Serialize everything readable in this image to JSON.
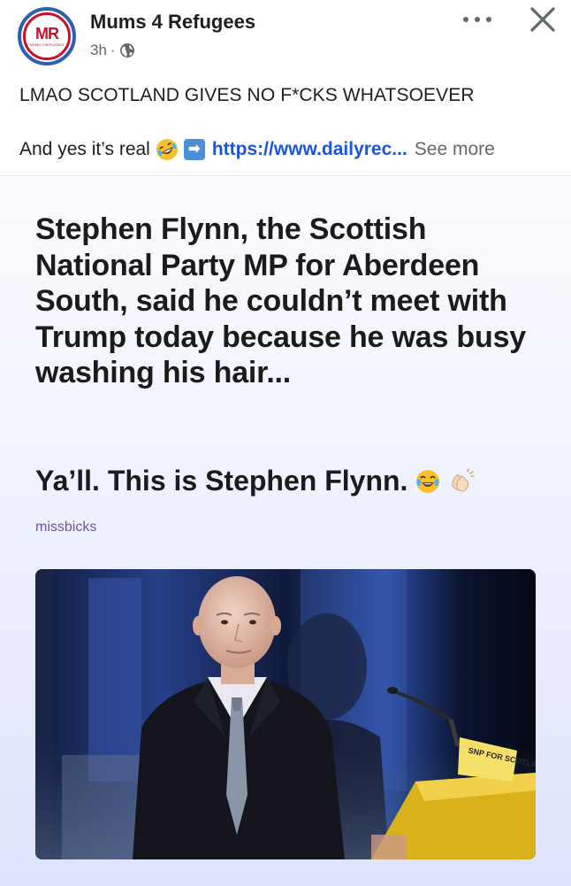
{
  "post": {
    "page_name": "Mums 4 Refugees",
    "time": "3h",
    "separator": "·",
    "avatar_logo": "MR",
    "avatar_subtext": "MUMS 4 REFUGEES",
    "text_line_1": "LMAO SCOTLAND GIVES NO F*CKS WHATSOEVER",
    "text_line_2_prefix": "And yes it’s real",
    "link": "https://www.dailyrec...",
    "see_more": "See more"
  },
  "card": {
    "headline": "Stephen Flynn, the Scottish National Party MP for Aberdeen South, said he couldn’t meet with Trump today because he was busy washing his hair...",
    "subline": "Ya’ll. This is Stephen Flynn.",
    "author": "missbicks",
    "podium_sign": "SNP FOR SCOTLAND"
  },
  "icons": {
    "globe": "globe-icon",
    "more": "more-options-icon",
    "close": "close-icon",
    "laugh": "rolling-laughing-emoji",
    "arrow": "right-arrow-emoji",
    "tears": "tears-of-joy-emoji",
    "clap": "clapping-hands-emoji"
  },
  "colors": {
    "link": "#1a56db",
    "avatar_ring": "#2f5fb0",
    "avatar_logo": "#c8102e",
    "author": "#6f52a8",
    "meta": "#65676b"
  }
}
